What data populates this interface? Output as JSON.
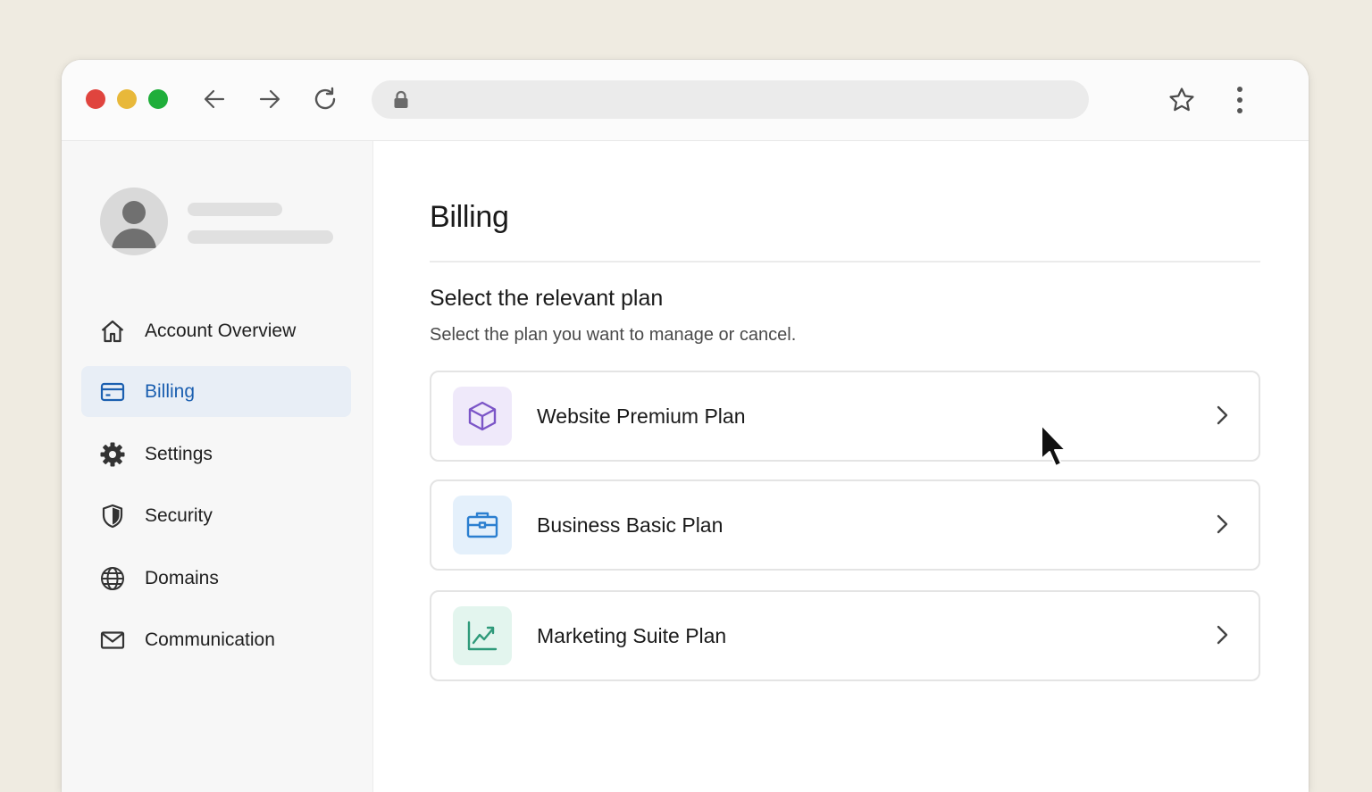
{
  "browser": {
    "address_value": ""
  },
  "sidebar": {
    "items": [
      {
        "label": "Account Overview",
        "icon": "home-icon",
        "active": false
      },
      {
        "label": "Billing",
        "icon": "credit-card-icon",
        "active": true
      },
      {
        "label": "Settings",
        "icon": "gear-icon",
        "active": false
      },
      {
        "label": "Security",
        "icon": "shield-icon",
        "active": false
      },
      {
        "label": "Domains",
        "icon": "globe-icon",
        "active": false
      },
      {
        "label": "Communication",
        "icon": "mail-icon",
        "active": false
      }
    ]
  },
  "main": {
    "title": "Billing",
    "section_title": "Select the relevant plan",
    "section_subtitle": "Select the plan you want to manage or cancel.",
    "plans": [
      {
        "label": "Website Premium Plan",
        "icon": "cube-icon",
        "icon_color": "#7b55c7",
        "icon_bg": "#efe9fa"
      },
      {
        "label": "Business Basic Plan",
        "icon": "briefcase-icon",
        "icon_color": "#2b7fd0",
        "icon_bg": "#e4f0fb"
      },
      {
        "label": "Marketing Suite Plan",
        "icon": "trend-chart-icon",
        "icon_color": "#2f9a7a",
        "icon_bg": "#e3f5ee"
      }
    ]
  },
  "colors": {
    "accent": "#1b5fb0",
    "active_bg": "#e8eef6",
    "traffic_red": "#e0443e",
    "traffic_yellow": "#e8b83a",
    "traffic_green": "#1fae3a"
  }
}
